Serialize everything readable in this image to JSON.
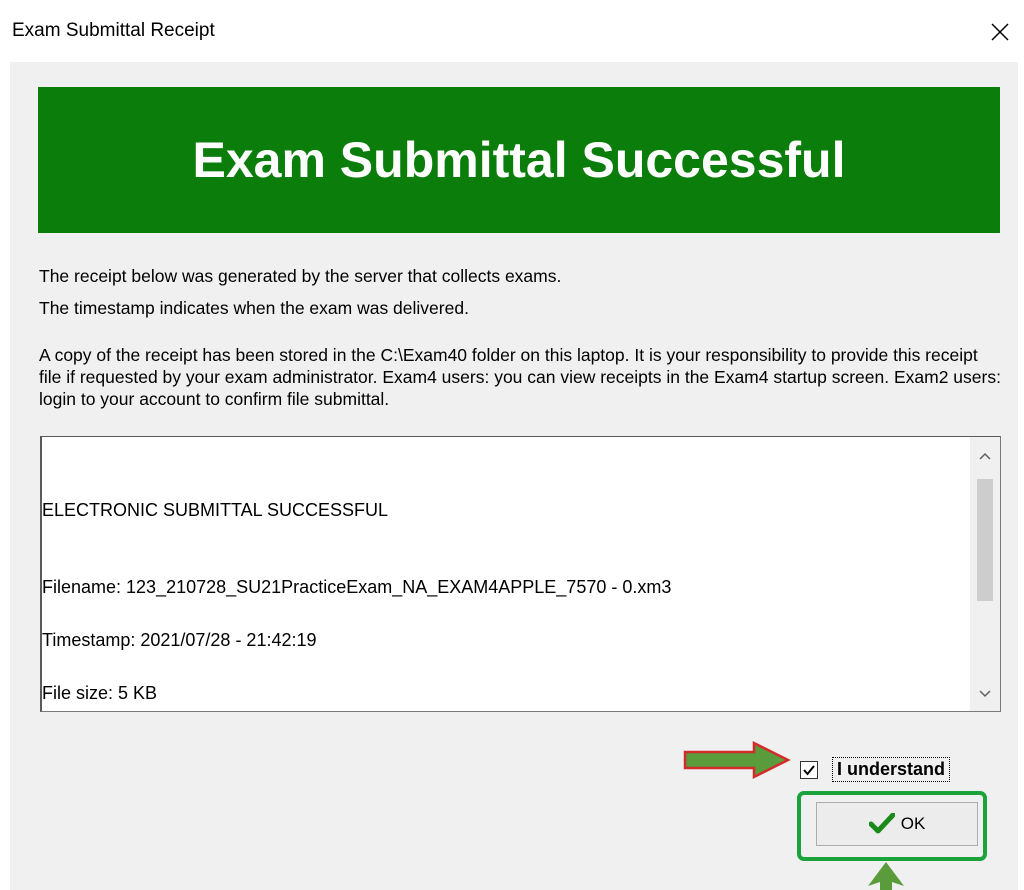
{
  "window": {
    "title": "Exam Submittal Receipt",
    "close_label": "×"
  },
  "banner": {
    "text": "Exam Submittal Successful",
    "color": "#0b7d0b"
  },
  "info": {
    "line1": "The receipt below was generated by the server that collects exams.",
    "line2": "The timestamp indicates when the exam was delivered.",
    "paragraph": "A copy of the receipt has been stored in the C:\\Exam40 folder on this laptop. It is your responsibility to provide this receipt file if requested by your exam administrator. Exam4 users: you can view receipts in the Exam4 startup screen. Exam2 users: login to your account to confirm file submittal."
  },
  "receipt": {
    "lines": [
      "ELECTRONIC SUBMITTAL SUCCESSFUL",
      "Filename: 123_210728_SU21PracticeExam_NA_EXAM4APPLE_7570 - 0.xm3",
      "Timestamp: 2021/07/28 - 21:42:19",
      "File size: 5 KB"
    ]
  },
  "acknowledge": {
    "label": "I understand",
    "checked": true
  },
  "ok_button": {
    "label": "OK"
  },
  "colors": {
    "annotation_arrow_fill": "#5a9b3c",
    "annotation_arrow_border": "#d42a2a",
    "highlight_border": "#1aa33b"
  },
  "icons": [
    "close-icon",
    "scroll-up-icon",
    "scroll-down-icon",
    "checkmark-icon",
    "annotation-arrow-right",
    "annotation-arrow-up"
  ]
}
